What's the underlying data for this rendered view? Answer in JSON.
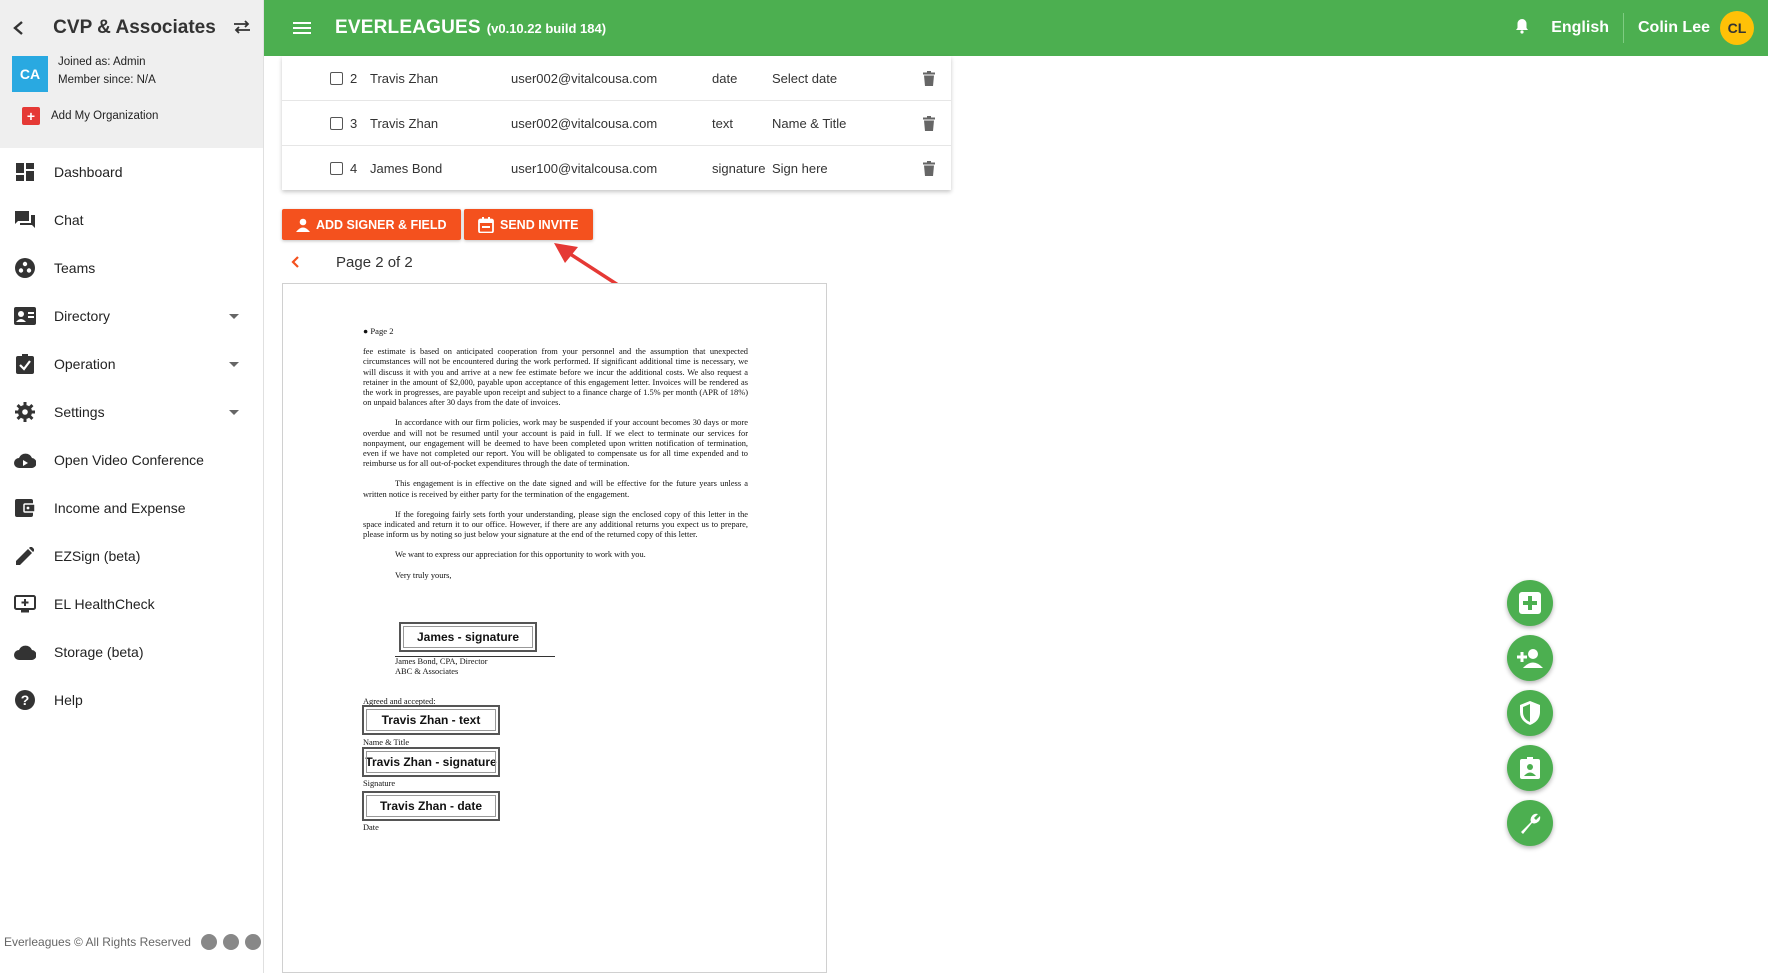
{
  "sidebar": {
    "org_name": "CVP & Associates",
    "avatar_initials": "CA",
    "joined": "Joined as: Admin",
    "member_since": "Member since: N/A",
    "add_org": "Add My Organization",
    "items": [
      {
        "label": "Dashboard",
        "icon": "dashboard-icon"
      },
      {
        "label": "Chat",
        "icon": "chat-icon"
      },
      {
        "label": "Teams",
        "icon": "teams-icon"
      },
      {
        "label": "Directory",
        "icon": "contacts-icon"
      },
      {
        "label": "Operation",
        "icon": "clipboard-check-icon"
      },
      {
        "label": "Settings",
        "icon": "gear-icon"
      },
      {
        "label": "Open Video Conference",
        "icon": "cloud-video-icon"
      },
      {
        "label": "Income and Expense",
        "icon": "wallet-icon"
      },
      {
        "label": "EZSign (beta)",
        "icon": "pencil-icon"
      },
      {
        "label": "EL HealthCheck",
        "icon": "monitor-plus-icon"
      },
      {
        "label": "Storage (beta)",
        "icon": "cloud-icon"
      },
      {
        "label": "Help",
        "icon": "help-icon"
      }
    ],
    "footer": "Everleagues © All Rights Reserved"
  },
  "topbar": {
    "title": "EVERLEAGUES",
    "version": "(v0.10.22 build 184)",
    "language": "English",
    "user_name": "Colin Lee",
    "user_initials": "CL"
  },
  "signers": {
    "rows": [
      {
        "num": "2",
        "name": "Travis Zhan",
        "email": "user002@vitalcousa.com",
        "type": "date",
        "label": "Select date"
      },
      {
        "num": "3",
        "name": "Travis Zhan",
        "email": "user002@vitalcousa.com",
        "type": "text",
        "label": "Name & Title"
      },
      {
        "num": "4",
        "name": "James Bond",
        "email": "user100@vitalcousa.com",
        "type": "signature",
        "label": "Sign here"
      }
    ]
  },
  "actions": {
    "add_signer": "ADD SIGNER & FIELD",
    "send_invite": "SEND INVITE"
  },
  "pager": {
    "label": "Page 2 of 2"
  },
  "document": {
    "bullet": "Page 2",
    "p1": "fee estimate is based on anticipated cooperation from your personnel and the assumption that unexpected circumstances will not be encountered during the work performed. If significant additional time is necessary, we will discuss it with you and arrive at a new fee estimate before we incur the additional costs. We also request a retainer in the amount of $2,000, payable upon acceptance of this engagement letter. Invoices will be rendered as the work in progresses, are payable upon receipt and subject to a finance charge of 1.5% per month (APR of 18%) on unpaid balances after 30 days from the date of invoices.",
    "p2": "In accordance with our firm policies, work may be suspended if your account becomes 30 days or more overdue and will not be resumed until your account is paid in full. If we elect to terminate our services for nonpayment, our engagement will be deemed to have been completed upon written notification of termination, even if we have not completed our report. You will be obligated to compensate us for all time expended and to reimburse us for all out-of-pocket expenditures through the date of termination.",
    "p3": "This engagement is in effective on the date signed and will be effective for the future years unless a written notice is received by either party for the termination of the engagement.",
    "p4": "If the foregoing fairly sets forth your understanding, please sign the enclosed copy of this letter in the space indicated and return it to our office. However, if there are any additional returns you expect us to prepare, please inform us by noting so just below your signature at the end of the returned copy of this letter.",
    "p5": "We want to express our appreciation for this opportunity to work with you.",
    "closing": "Very truly yours,",
    "sig_field": "James - signature",
    "signer_line1": "James Bond, CPA, Director",
    "signer_line2": "ABC & Associates",
    "agreed": "Agreed and accepted:",
    "text_field": "Travis Zhan - text",
    "name_title": "Name & Title",
    "sig2_field": "Travis Zhan - signature",
    "signature_label": "Signature",
    "date_field": "Travis Zhan - date",
    "date_label": "Date"
  },
  "colors": {
    "brand": "#4caf50",
    "accent": "#f4511e",
    "avatar": "#29a9e1",
    "user_badge": "#ffc107"
  }
}
